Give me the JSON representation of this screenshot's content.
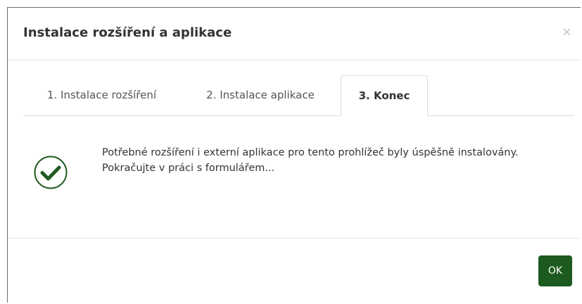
{
  "dialog": {
    "title": "Instalace rozšíření a aplikace",
    "close_label": "×"
  },
  "tabs": [
    {
      "label": "1. Instalace rozšíření",
      "active": false
    },
    {
      "label": "2. Instalace aplikace",
      "active": false
    },
    {
      "label": "3. Konec",
      "active": true
    }
  ],
  "content": {
    "icon": "check-circle-icon",
    "line1": "Potřebné rozšíření i externí aplikace pro tento prohlížeč byly úspěšně instalovány.",
    "line2": "Pokračujte v práci s formulářem..."
  },
  "footer": {
    "ok_label": "OK"
  },
  "colors": {
    "accent": "#1c5a1f",
    "check": "#1f5a22"
  }
}
